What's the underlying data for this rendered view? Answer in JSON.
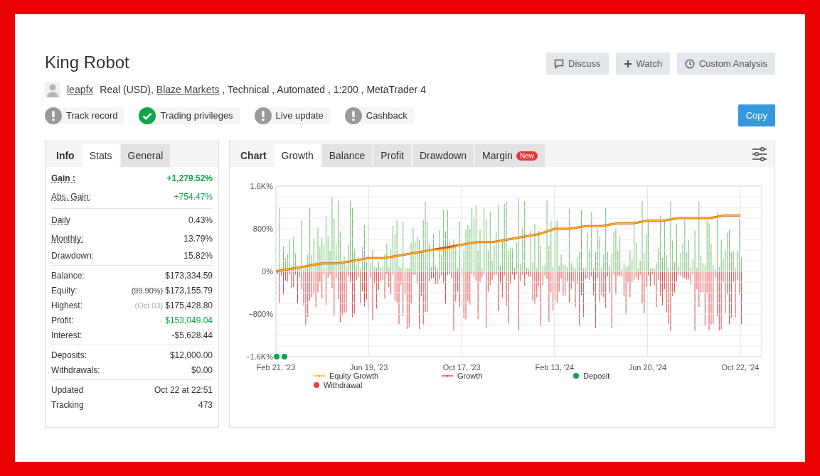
{
  "title": "King Robot",
  "actions": [
    {
      "label": "Discuss"
    },
    {
      "label": "Watch"
    },
    {
      "label": "Custom Analysis"
    }
  ],
  "meta": {
    "user": "leapfx",
    "parts": [
      {
        "text": "Real (USD),",
        "link": false
      },
      {
        "text": "Blaze Markets",
        "link": true
      },
      {
        "text": ", Technical , Automated , 1:200 , MetaTrader 4",
        "link": false
      }
    ]
  },
  "badges": [
    {
      "label": "Track record",
      "verified": false
    },
    {
      "label": "Trading privileges",
      "verified": true
    },
    {
      "label": "Live update",
      "verified": false
    },
    {
      "label": "Cashback",
      "verified": false
    }
  ],
  "copy_button": "Copy",
  "stats_panel": {
    "heading": "Info",
    "tabs": [
      {
        "label": "Stats",
        "selected": true
      },
      {
        "label": "General",
        "selected": false
      }
    ],
    "groups": [
      [
        {
          "label": "Gain :",
          "value": "+1,279.52%",
          "dotted": true,
          "strong": true,
          "positive": true
        },
        {
          "label": "Abs. Gain:",
          "value": "+754.47%",
          "dotted": true,
          "strong": false,
          "positive": true
        }
      ],
      [
        {
          "label": "Daily",
          "value": "0.43%",
          "dotted": true,
          "strong": false,
          "positive": false
        },
        {
          "label": "Monthly:",
          "value": "13.79%",
          "dotted": true,
          "strong": false,
          "positive": false
        },
        {
          "label": "Drawdown:",
          "value": "15.82%",
          "dotted": false,
          "strong": false,
          "positive": false
        }
      ],
      [
        {
          "label": "Balance:",
          "value": "$173,334.59",
          "dotted": false,
          "strong": false,
          "positive": false
        },
        {
          "label": "Equity:",
          "note": "(99.90%)",
          "note_muted": false,
          "value": "$173,155.79",
          "dotted": false,
          "strong": false,
          "positive": false
        },
        {
          "label": "Highest:",
          "note": "(Oct 03)",
          "note_muted": true,
          "value": "$175,428.80",
          "dotted": false,
          "strong": false,
          "positive": false
        },
        {
          "label": "Profit:",
          "value": "$153,049.04",
          "dotted": false,
          "strong": false,
          "positive": true
        },
        {
          "label": "Interest:",
          "value": "-$5,628.44",
          "dotted": false,
          "strong": false,
          "positive": false
        }
      ],
      [
        {
          "label": "Deposits:",
          "value": "$12,000.00",
          "dotted": false,
          "strong": false,
          "positive": false
        },
        {
          "label": "Withdrawals:",
          "value": "$0.00",
          "dotted": false,
          "strong": false,
          "positive": false
        }
      ],
      [
        {
          "label": "Updated",
          "value": "Oct 22 at 22:51",
          "dotted": false,
          "strong": false,
          "positive": false
        },
        {
          "label": "Tracking",
          "value": "473",
          "dotted": false,
          "strong": false,
          "positive": false
        }
      ]
    ]
  },
  "chart_panel": {
    "heading": "Chart",
    "tabs": [
      {
        "label": "Growth",
        "selected": true
      },
      {
        "label": "Balance",
        "selected": false
      },
      {
        "label": "Profit",
        "selected": false
      },
      {
        "label": "Drawdown",
        "selected": false
      },
      {
        "label": "Margin",
        "selected": false,
        "badge": "New"
      }
    ],
    "event_markers": [
      {
        "name": "Deposit",
        "color": "#0aa64a"
      },
      {
        "name": "Withdrawal",
        "color": "#e8423c"
      }
    ],
    "chart_data": {
      "type": "line",
      "grid": true,
      "categories": [
        "Feb 21, '23",
        null,
        null,
        null,
        null,
        null,
        "Jun 19, '23",
        null,
        null,
        null,
        null,
        null,
        "Oct 17, '23",
        null,
        null,
        null,
        null,
        null,
        "Feb 13, '24",
        null,
        null,
        null,
        null,
        null,
        "Jun 20, '24",
        null,
        null,
        null,
        null,
        null,
        "Oct 22, '24"
      ],
      "series": [
        {
          "name": "Equity Growth",
          "color": "#f5c400",
          "values": [
            0,
            50,
            100,
            150,
            150,
            200,
            250,
            250,
            300,
            350,
            400,
            400,
            500,
            550,
            550,
            600,
            650,
            700,
            800,
            800,
            850,
            850,
            900,
            900,
            950,
            950,
            1000,
            1000,
            1000,
            1050,
            1050
          ]
        },
        {
          "name": "Growth",
          "color": "#e2532d",
          "values": [
            0,
            50,
            100,
            150,
            150,
            200,
            250,
            250,
            300,
            350,
            400,
            450,
            500,
            550,
            550,
            600,
            650,
            700,
            800,
            800,
            850,
            850,
            900,
            900,
            950,
            950,
            1000,
            1000,
            1000,
            1050,
            1050
          ]
        }
      ],
      "ylim": [
        -1600,
        1600
      ],
      "yticks": [
        {
          "value": -1600,
          "label": "−1.6K%"
        },
        {
          "value": -800,
          "label": "−800%"
        },
        {
          "value": 0,
          "label": "0%"
        },
        {
          "value": 800,
          "label": "800%"
        },
        {
          "value": 1600,
          "label": "1.6K%"
        }
      ]
    }
  }
}
